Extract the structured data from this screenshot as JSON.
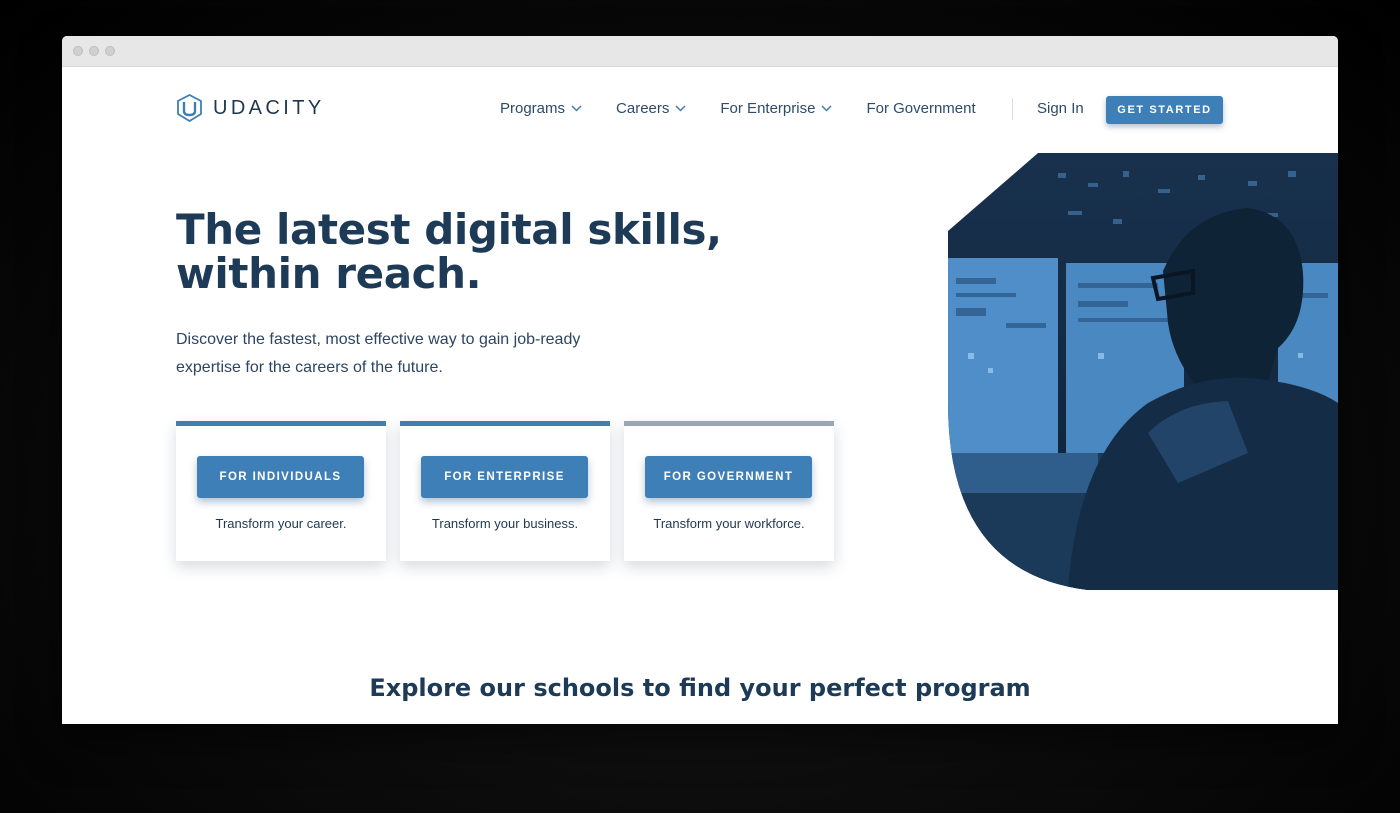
{
  "brand": {
    "name": "UDACITY",
    "accent": "#3d7fb6",
    "text_dark": "#1d3a56"
  },
  "nav": {
    "items": [
      {
        "label": "Programs",
        "has_dropdown": true
      },
      {
        "label": "Careers",
        "has_dropdown": true
      },
      {
        "label": "For Enterprise",
        "has_dropdown": true
      },
      {
        "label": "For Government",
        "has_dropdown": false
      }
    ],
    "sign_in": "Sign In",
    "cta": "GET STARTED"
  },
  "hero": {
    "title_line1": "The latest digital skills,",
    "title_line2": "within reach.",
    "subtitle_line1": "Discover the fastest, most effective way to gain job-ready",
    "subtitle_line2": "expertise for the careers of the future."
  },
  "cards": [
    {
      "button": "FOR INDIVIDUALS",
      "caption": "Transform your career."
    },
    {
      "button": "FOR ENTERPRISE",
      "caption": "Transform your business."
    },
    {
      "button": "FOR GOVERNMENT",
      "caption": "Transform your workforce."
    }
  ],
  "explore_heading": "Explore our schools to find your perfect program",
  "icons": {
    "logo": "udacity-logo-icon",
    "dropdown": "chevron-down-icon"
  }
}
